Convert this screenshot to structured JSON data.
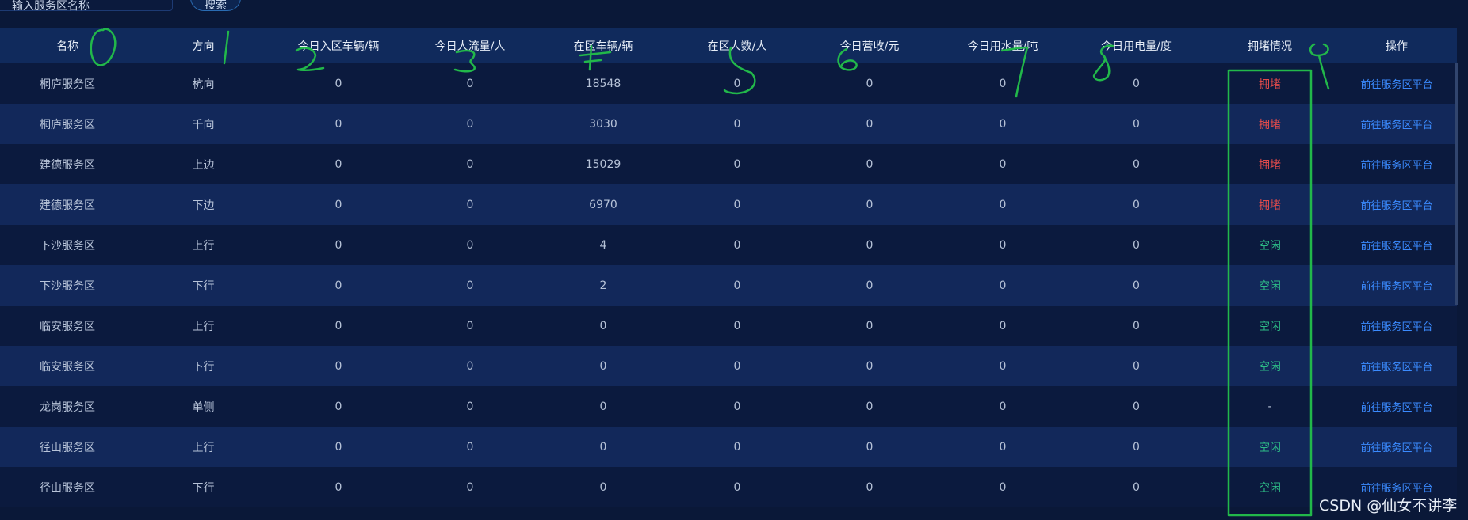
{
  "search": {
    "value": "输入服务区名称",
    "button_label": "搜索"
  },
  "table": {
    "headers": [
      "名称",
      "方向",
      "今日入区车辆/辆",
      "今日人流量/人",
      "在区车辆/辆",
      "在区人数/人",
      "今日营收/元",
      "今日用水量/吨",
      "今日用电量/度",
      "拥堵情况",
      "操作"
    ],
    "rows": [
      {
        "name": "桐庐服务区",
        "direction": "杭向",
        "c2": "0",
        "c3": "0",
        "c4": "18548",
        "c5": "0",
        "c6": "0",
        "c7": "0",
        "c8": "0",
        "status": "拥堵",
        "action": "前往服务区平台"
      },
      {
        "name": "桐庐服务区",
        "direction": "千向",
        "c2": "0",
        "c3": "0",
        "c4": "3030",
        "c5": "0",
        "c6": "0",
        "c7": "0",
        "c8": "0",
        "status": "拥堵",
        "action": "前往服务区平台"
      },
      {
        "name": "建德服务区",
        "direction": "上边",
        "c2": "0",
        "c3": "0",
        "c4": "15029",
        "c5": "0",
        "c6": "0",
        "c7": "0",
        "c8": "0",
        "status": "拥堵",
        "action": "前往服务区平台"
      },
      {
        "name": "建德服务区",
        "direction": "下边",
        "c2": "0",
        "c3": "0",
        "c4": "6970",
        "c5": "0",
        "c6": "0",
        "c7": "0",
        "c8": "0",
        "status": "拥堵",
        "action": "前往服务区平台"
      },
      {
        "name": "下沙服务区",
        "direction": "上行",
        "c2": "0",
        "c3": "0",
        "c4": "4",
        "c5": "0",
        "c6": "0",
        "c7": "0",
        "c8": "0",
        "status": "空闲",
        "action": "前往服务区平台"
      },
      {
        "name": "下沙服务区",
        "direction": "下行",
        "c2": "0",
        "c3": "0",
        "c4": "2",
        "c5": "0",
        "c6": "0",
        "c7": "0",
        "c8": "0",
        "status": "空闲",
        "action": "前往服务区平台"
      },
      {
        "name": "临安服务区",
        "direction": "上行",
        "c2": "0",
        "c3": "0",
        "c4": "0",
        "c5": "0",
        "c6": "0",
        "c7": "0",
        "c8": "0",
        "status": "空闲",
        "action": "前往服务区平台"
      },
      {
        "name": "临安服务区",
        "direction": "下行",
        "c2": "0",
        "c3": "0",
        "c4": "0",
        "c5": "0",
        "c6": "0",
        "c7": "0",
        "c8": "0",
        "status": "空闲",
        "action": "前往服务区平台"
      },
      {
        "name": "龙岗服务区",
        "direction": "单侧",
        "c2": "0",
        "c3": "0",
        "c4": "0",
        "c5": "0",
        "c6": "0",
        "c7": "0",
        "c8": "0",
        "status": "-",
        "action": "前往服务区平台"
      },
      {
        "name": "径山服务区",
        "direction": "上行",
        "c2": "0",
        "c3": "0",
        "c4": "0",
        "c5": "0",
        "c6": "0",
        "c7": "0",
        "c8": "0",
        "status": "空闲",
        "action": "前往服务区平台"
      },
      {
        "name": "径山服务区",
        "direction": "下行",
        "c2": "0",
        "c3": "0",
        "c4": "0",
        "c5": "0",
        "c6": "0",
        "c7": "0",
        "c8": "0",
        "status": "空闲",
        "action": "前往服务区平台"
      }
    ]
  },
  "annotations": {
    "color": "#22b84a",
    "digits": [
      "0",
      "1",
      "2",
      "3",
      "4",
      "5",
      "6",
      "7",
      "8",
      "9"
    ]
  },
  "watermark": "CSDN @仙女不讲李",
  "colors": {
    "busy": "#e24b4b",
    "idle": "#2dbb86",
    "link": "#3b8bff",
    "header_bg": "#102a5c"
  }
}
